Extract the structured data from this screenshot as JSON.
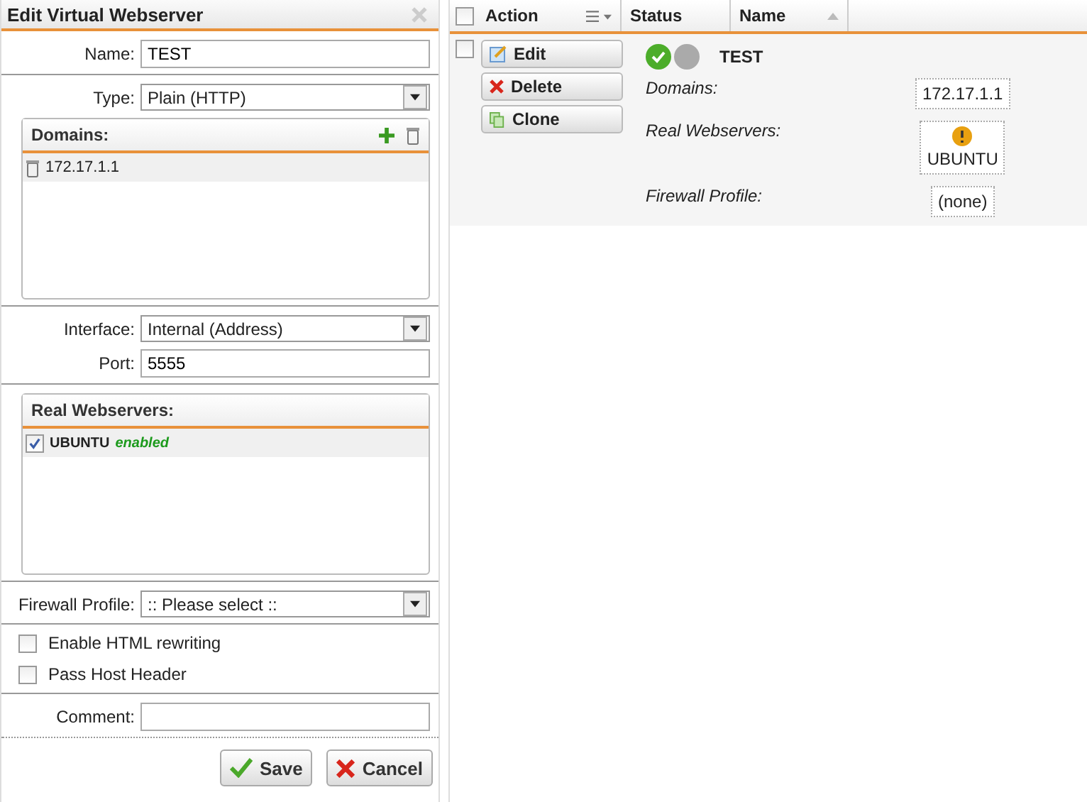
{
  "dialog": {
    "title": "Edit Virtual Webserver",
    "name": {
      "label": "Name:",
      "value": "TEST"
    },
    "type": {
      "label": "Type:",
      "value": "Plain (HTTP)"
    },
    "domains": {
      "title": "Domains:",
      "items": [
        {
          "text": "172.17.1.1"
        }
      ]
    },
    "interface": {
      "label": "Interface:",
      "value": "Internal (Address)"
    },
    "port": {
      "label": "Port:",
      "value": "5555"
    },
    "real_webservers": {
      "title": "Real Webservers:",
      "items": [
        {
          "name": "UBUNTU",
          "status": "enabled",
          "checked": true
        }
      ]
    },
    "firewall_profile": {
      "label": "Firewall Profile:",
      "value": ":: Please select ::"
    },
    "options": [
      {
        "label": "Enable HTML rewriting",
        "checked": false
      },
      {
        "label": "Pass Host Header",
        "checked": false
      }
    ],
    "comment": {
      "label": "Comment:"
    },
    "buttons": [
      {
        "kind": "save",
        "label": "Save"
      },
      {
        "kind": "cancel",
        "label": "Cancel"
      }
    ]
  },
  "table": {
    "select_all": {
      "checked": false
    },
    "columns": [
      {
        "label": "Action",
        "kind": "menu"
      },
      {
        "label": "Status",
        "kind": "plain"
      },
      {
        "label": "Name",
        "kind": "sort"
      }
    ],
    "rows": [
      {
        "checked": false,
        "actions": [
          {
            "kind": "edit",
            "label": "Edit"
          },
          {
            "kind": "delete",
            "label": "Delete"
          },
          {
            "kind": "clone",
            "label": "Clone"
          }
        ],
        "status": [
          {
            "kind": "ok"
          },
          {
            "kind": "inactive"
          }
        ],
        "name": "TEST",
        "details": [
          {
            "label": "Domains:",
            "values": [
              {
                "text": "172.17.1.1"
              }
            ]
          },
          {
            "label": "Real Webservers:",
            "values": [
              {
                "text": "UBUNTU",
                "warning": true
              }
            ]
          },
          {
            "label": "Firewall Profile:",
            "values": [
              {
                "text": "(none)"
              }
            ]
          }
        ]
      }
    ]
  }
}
